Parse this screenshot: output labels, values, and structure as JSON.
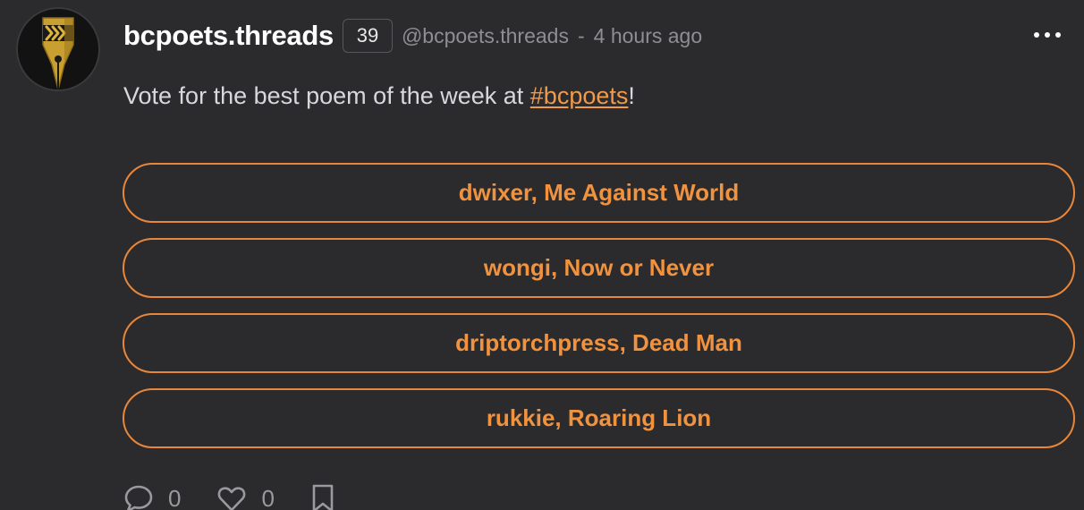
{
  "post": {
    "username": "bcpoets.threads",
    "reputation": "39",
    "handle": "@bcpoets.threads",
    "separator": "-",
    "timestamp": "4 hours ago",
    "avatar_icon": "fountain-pen-nib-icon",
    "more_icon": "more-dots-icon",
    "text_before": "Vote for the best poem of the week at ",
    "hashtag": "#bcpoets",
    "text_after": "!"
  },
  "poll": {
    "options": [
      "dwixer, Me Against World",
      "wongi, Now or Never",
      "driptorchpress, Dead Man",
      "rukkie, Roaring Lion"
    ]
  },
  "actions": {
    "comments": "0",
    "likes": "0",
    "comment_icon": "comment-bubble-icon",
    "like_icon": "heart-icon",
    "bookmark_icon": "bookmark-icon"
  },
  "colors": {
    "background": "#2b2b2e",
    "accent": "#f0923e",
    "avatar_gold": "#d4a72c"
  }
}
